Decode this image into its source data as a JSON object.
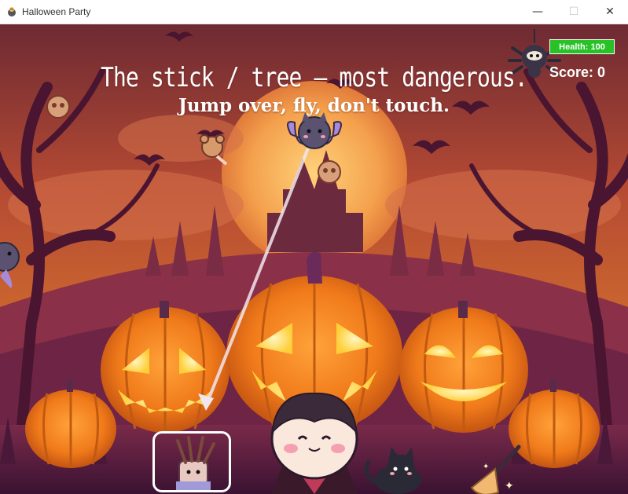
{
  "window": {
    "title": "Halloween Party",
    "controls": {
      "minimize": "—",
      "maximize": "☐",
      "close": "✕"
    }
  },
  "hud": {
    "title": "The stick / tree — most dangerous.",
    "subtitle": "Jump over, fly, don't touch.",
    "health_label": "Health: 100",
    "health_value": 100,
    "score_label": "Score: 0"
  },
  "characters": {
    "player": "vampire-boy",
    "items": [
      "stick-tree-monster",
      "black-cat",
      "witch-broom"
    ],
    "flying": [
      "bat-enemy",
      "spider-enemy",
      "cookie-skull",
      "lollipop-teddy"
    ]
  },
  "colors": {
    "sky_top": "#7a2b2f",
    "sky_mid": "#c8582f",
    "moon": "#f7b25b",
    "pumpkin": "#f07a1a",
    "health_bar": "#26c226"
  }
}
